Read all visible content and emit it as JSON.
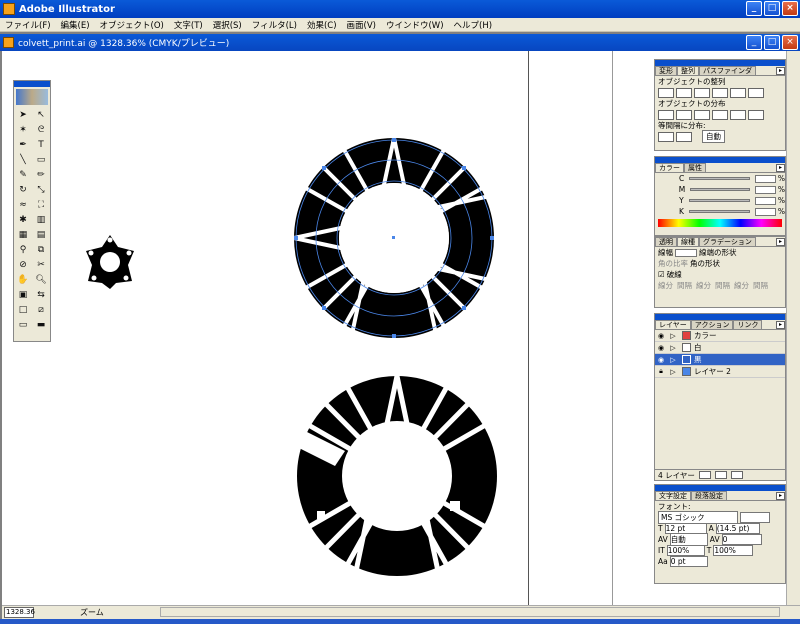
{
  "app": {
    "title": "Adobe Illustrator"
  },
  "menu": [
    "ファイル(F)",
    "編集(E)",
    "オブジェクト(O)",
    "文字(T)",
    "選択(S)",
    "フィルタ(L)",
    "効果(C)",
    "画面(V)",
    "ウインドウ(W)",
    "ヘルプ(H)"
  ],
  "document": {
    "title": "colvett_print.ai @ 1328.36% (CMYK/プレビュー)"
  },
  "status": {
    "zoom": "1328.36",
    "label": "ズーム"
  },
  "align_panel": {
    "tabs": [
      "変形",
      "整列",
      "パスファインダ"
    ],
    "section1": "オブジェクトの整列",
    "section2": "オブジェクトの分布",
    "section3": "等間隔に分布:",
    "spacing_value": "自動"
  },
  "color_panel": {
    "tabs": [
      "カラー",
      "属性"
    ],
    "channels": [
      "C",
      "M",
      "Y",
      "K"
    ],
    "unit": "%"
  },
  "stroke_panel": {
    "tabs": [
      "透明",
      "線種",
      "グラデーション"
    ],
    "weight_label": "線幅",
    "cap_label": "線端の形状",
    "corner_limit_label": "角の比率",
    "join_label": "角の形状",
    "dash_label": "破線",
    "dash_fields": [
      "線分",
      "間隔",
      "線分",
      "間隔",
      "線分",
      "間隔"
    ]
  },
  "layers_panel": {
    "tabs": [
      "レイヤー",
      "アクション",
      "リンク"
    ],
    "layers": [
      {
        "name": "カラー",
        "selected": false
      },
      {
        "name": "白",
        "selected": false
      },
      {
        "name": "黒",
        "selected": true
      },
      {
        "name": "レイヤー 2",
        "selected": false
      }
    ],
    "footer": "4 レイヤー"
  },
  "char_panel": {
    "tabs": [
      "文字設定",
      "段落設定"
    ],
    "font_label": "フォント:",
    "font_name": "MS ゴシック",
    "size": "12 pt",
    "leading": "(14.5 pt)",
    "tracking": "自動",
    "kerning": "0",
    "vscale": "100%",
    "hscale": "100%",
    "baseline": "0 pt"
  },
  "colors": {
    "title_blue": "#0a5ad8",
    "chrome": "#ece9d8",
    "selection": "#3163c5"
  }
}
